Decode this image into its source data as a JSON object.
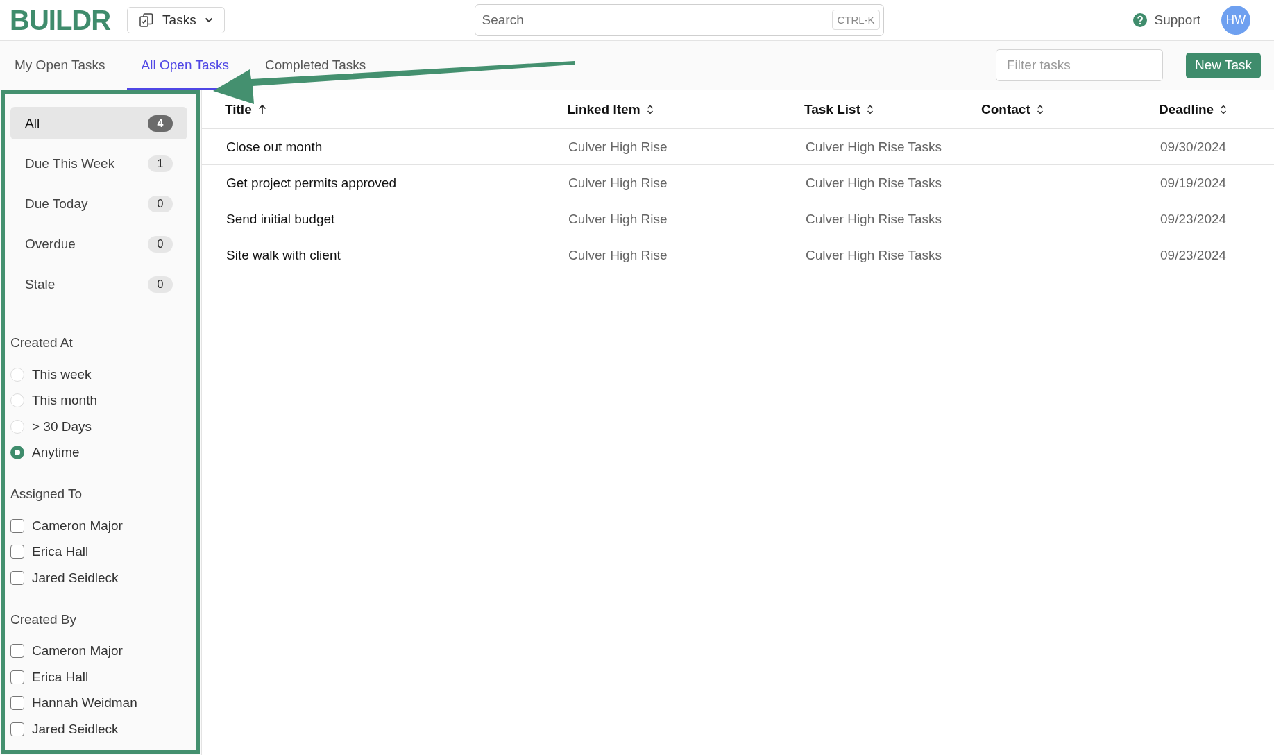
{
  "header": {
    "logo": "BUILDR",
    "module_menu": {
      "label": "Tasks"
    },
    "search": {
      "placeholder": "Search",
      "shortcut": "CTRL-K"
    },
    "support": "Support",
    "avatar": "HW"
  },
  "tabs": [
    {
      "label": "My Open Tasks",
      "selected": false
    },
    {
      "label": "All Open Tasks",
      "selected": true
    },
    {
      "label": "Completed Tasks",
      "selected": false
    }
  ],
  "filter": {
    "placeholder": "Filter tasks"
  },
  "new_task_button": "New Task",
  "sidebar": {
    "views": [
      {
        "label": "All",
        "count": "4",
        "selected": true
      },
      {
        "label": "Due This Week",
        "count": "1",
        "selected": false
      },
      {
        "label": "Due Today",
        "count": "0",
        "selected": false
      },
      {
        "label": "Overdue",
        "count": "0",
        "selected": false
      },
      {
        "label": "Stale",
        "count": "0",
        "selected": false
      }
    ],
    "created_at": {
      "title": "Created At",
      "options": [
        {
          "label": "This week",
          "selected": false
        },
        {
          "label": "This month",
          "selected": false
        },
        {
          "label": "> 30 Days",
          "selected": false
        },
        {
          "label": "Anytime",
          "selected": true
        }
      ]
    },
    "assigned_to": {
      "title": "Assigned To",
      "options": [
        {
          "label": "Cameron Major",
          "checked": false
        },
        {
          "label": "Erica Hall",
          "checked": false
        },
        {
          "label": "Jared Seidleck",
          "checked": false
        }
      ]
    },
    "created_by": {
      "title": "Created By",
      "options": [
        {
          "label": "Cameron Major",
          "checked": false
        },
        {
          "label": "Erica Hall",
          "checked": false
        },
        {
          "label": "Hannah Weidman",
          "checked": false
        },
        {
          "label": "Jared Seidleck",
          "checked": false
        }
      ]
    }
  },
  "table": {
    "columns": [
      {
        "label": "Title",
        "sorted": true
      },
      {
        "label": "Linked Item",
        "sorted": false
      },
      {
        "label": "Task List",
        "sorted": false
      },
      {
        "label": "Contact",
        "sorted": false
      },
      {
        "label": "Deadline",
        "sorted": false
      }
    ],
    "rows": [
      {
        "title": "Close out month",
        "linked_item": "Culver High Rise",
        "task_list": "Culver High Rise Tasks",
        "deadline": "09/30/2024"
      },
      {
        "title": "Get project permits approved",
        "linked_item": "Culver High Rise",
        "task_list": "Culver High Rise Tasks",
        "deadline": "09/19/2024"
      },
      {
        "title": "Send initial budget",
        "linked_item": "Culver High Rise",
        "task_list": "Culver High Rise Tasks",
        "deadline": "09/23/2024"
      },
      {
        "title": "Site walk with client",
        "linked_item": "Culver High Rise",
        "task_list": "Culver High Rise Tasks",
        "deadline": "09/23/2024"
      }
    ]
  }
}
